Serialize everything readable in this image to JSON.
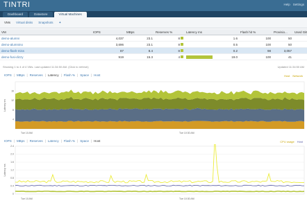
{
  "app": {
    "title": "TINTRI"
  },
  "topbar": {
    "links": [
      "Help",
      "Settings"
    ]
  },
  "tabs": [
    {
      "label": "Dashboard"
    },
    {
      "label": "Datastore"
    },
    {
      "label": "Virtual Machines"
    }
  ],
  "subtabs": [
    {
      "label": "VMs"
    },
    {
      "label": "Virtual disks"
    },
    {
      "label": "Snapshots"
    },
    {
      "label": "✦"
    }
  ],
  "grid": {
    "columns": [
      "VM",
      "IOPS",
      "MBps",
      "Reserves %",
      "Latency ms",
      "Flash hit %",
      "Provisio...",
      "Used GiB"
    ],
    "rows": [
      {
        "vm": "demo-alumni",
        "iops": "4,037",
        "mbps": "23.1",
        "res": "8",
        "lat": "1.6",
        "latfrac": 0.0,
        "flash": "100",
        "prov": "50",
        "used": ""
      },
      {
        "vm": "demo-alumnino",
        "iops": "3,696",
        "mbps": "23.1",
        "res": "8",
        "lat": "0.5",
        "latfrac": 0.0,
        "flash": "100",
        "prov": "50",
        "used": ""
      },
      {
        "vm": "demo-flash-miss",
        "iops": "87",
        "mbps": "8.4",
        "res": "8",
        "lat": "0.2",
        "latfrac": 0.0,
        "flash": "98",
        "prov": "3,057",
        "used": ""
      },
      {
        "vm": "demo-fusi-dizzy",
        "iops": "919",
        "mbps": "15.3",
        "res": "4",
        "lat": "19.0",
        "latfrac": 0.75,
        "flash": "100",
        "prov": "41",
        "used": ""
      }
    ]
  },
  "status": {
    "left": "Showing 1 to 4 of 4 VMs. Last updated 11:34:50 AM. (Click to refresh)",
    "right": "Updated 11:34:50 AM"
  },
  "chart1": {
    "tabs": [
      "IOPS",
      "MBps",
      "Reserves",
      "Latency",
      "Flash %",
      "Space",
      "Host"
    ],
    "active": "Latency",
    "legend": [
      "Host",
      "Network"
    ],
    "ylabel": "Latency ms",
    "yticks": [
      "16",
      "12",
      "8",
      "4"
    ],
    "xticks": [
      "Tue 10 AM",
      "Tue 10:30 AM"
    ]
  },
  "chart2": {
    "tabs": [
      "IOPS",
      "MBps",
      "Reserves",
      "Latency",
      "Flash %",
      "Space",
      "Host"
    ],
    "active": "Host",
    "legend": [
      "CPU usage",
      "Host"
    ],
    "ylabel": "Latency ms",
    "yticks": [
      "2.4",
      "2.0",
      "1.6",
      "1.2",
      "0.8",
      "0.4",
      "0"
    ],
    "xticks": [
      "Tue 10 AM",
      "Tue 10:30 AM"
    ]
  },
  "colors": {
    "brand": "#3a6d93",
    "link": "#3f79b0",
    "lime": "#b3c43a",
    "olive": "#7d8b2a",
    "slate": "#5a6e86",
    "orange": "#d39a25",
    "yellow": "#ecec3a",
    "purple": "#5a5fa8"
  }
}
